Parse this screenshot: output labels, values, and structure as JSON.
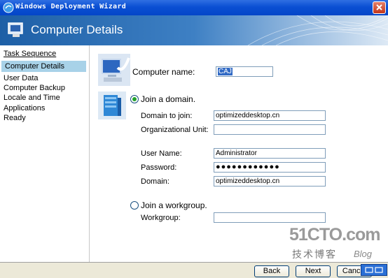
{
  "window": {
    "title": "Windows Deployment Wizard"
  },
  "header": {
    "title": "Computer Details"
  },
  "sidebar": {
    "heading": "Task Sequence",
    "items": [
      {
        "label": "Computer Details",
        "active": true
      },
      {
        "label": "User Data",
        "active": false
      },
      {
        "label": "Computer Backup",
        "active": false
      },
      {
        "label": "Locale and Time",
        "active": false
      },
      {
        "label": "Applications",
        "active": false
      },
      {
        "label": "Ready",
        "active": false
      }
    ]
  },
  "form": {
    "computer_name_label": "Computer name:",
    "computer_name_value": "CAJ",
    "join_domain_label": "Join a domain.",
    "join_domain_selected": true,
    "domain_to_join_label": "Domain to join:",
    "domain_to_join_value": "optimizeddesktop.cn",
    "ou_label": "Organizational Unit:",
    "ou_value": "",
    "username_label": "User Name:",
    "username_value": "Administrator",
    "password_label": "Password:",
    "password_value": "●●●●●●●●●●●●",
    "domain_label": "Domain:",
    "domain_value": "optimizeddesktop.cn",
    "join_workgroup_label": "Join a workgroup.",
    "join_workgroup_selected": false,
    "workgroup_label": "Workgroup:",
    "workgroup_value": ""
  },
  "footer": {
    "back_label": "Back",
    "next_label": "Next",
    "cancel_label": "Cancel"
  },
  "watermark": {
    "brand": "51CTO.com",
    "subtitle": "技术博客",
    "blog": "Blog"
  },
  "colors": {
    "titlebar": "#0a4fd3",
    "header_start": "#1d5fa6",
    "active_item": "#a8d2e8",
    "radio_selected": "#22a22a"
  }
}
